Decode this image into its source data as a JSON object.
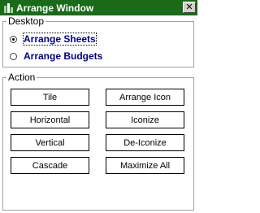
{
  "window": {
    "title": "Arrange Window",
    "close_glyph": "✕"
  },
  "desktop": {
    "legend": "Desktop",
    "options": [
      {
        "label": "Arrange Sheets",
        "checked": true
      },
      {
        "label": "Arrange Budgets",
        "checked": false
      }
    ]
  },
  "action": {
    "legend": "Action",
    "buttons": [
      {
        "label": "Tile"
      },
      {
        "label": "Arrange Icon"
      },
      {
        "label": "Horizontal"
      },
      {
        "label": "Iconize"
      },
      {
        "label": "Vertical"
      },
      {
        "label": "De-Iconize"
      },
      {
        "label": "Cascade"
      },
      {
        "label": "Maximize All"
      }
    ]
  },
  "colors": {
    "titlebar": "#1a6a1a",
    "radio_label": "#000080"
  }
}
